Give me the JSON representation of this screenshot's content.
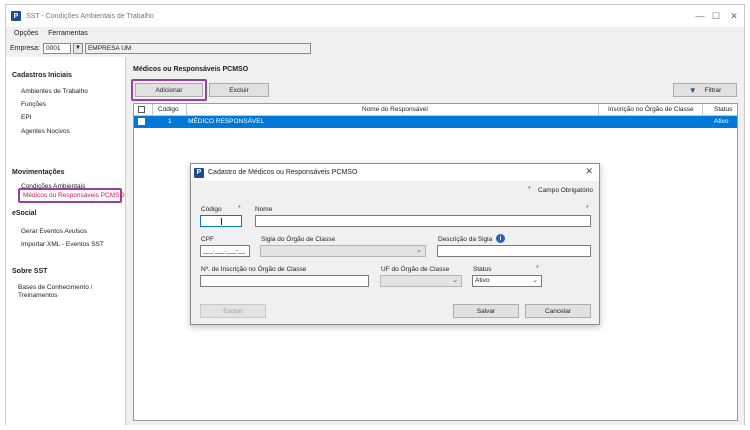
{
  "window": {
    "title": "SST - Condições Ambientais de Trabalho",
    "controls": {
      "minimize": "—",
      "maximize": "☐",
      "close": "✕"
    }
  },
  "menu": [
    "Opções",
    "Ferramentas"
  ],
  "empresa": {
    "label": "Empresa:",
    "code": "0001",
    "name": "EMPRESA UM"
  },
  "sidebar": {
    "sections": [
      {
        "title": "Cadastros Iniciais",
        "items": [
          "Ambientes de Trabalho",
          "Funções",
          "EPI",
          "Agentes Nocivos",
          "Médicos ou Responsáveis PCMSO"
        ]
      },
      {
        "title": "Movimentações",
        "items": [
          "Condições Ambientais"
        ]
      },
      {
        "title": "eSocial",
        "items": [
          "Gerar Eventos Avulsos",
          "Importar XML - Eventos SST"
        ]
      },
      {
        "title": "Sobre SST",
        "items": [
          "Bases de Conhecimento /",
          "Treinamentos"
        ]
      }
    ],
    "active_item": "Médicos ou Responsáveis PCMSO"
  },
  "main": {
    "title": "Médicos ou Responsáveis PCMSO",
    "buttons": {
      "add": "Adicionar",
      "delete": "Excluir",
      "filter": "Filtrar"
    },
    "grid": {
      "columns": [
        "Código",
        "Nome do Responsável",
        "Inscrição no Órgão de Classe",
        "Status"
      ],
      "rows": [
        {
          "codigo": "1",
          "nome": "MÉDICO RESPONSÁVEL",
          "inscricao": "",
          "status": "Ativo"
        }
      ]
    }
  },
  "dialog": {
    "title": "Cadastro de Médicos ou Responsáveis PCMSO",
    "required_note": "Campo Obrigatório",
    "required_mark": "*",
    "labels": {
      "codigo": "Código",
      "nome": "Nome",
      "cpf": "CPF",
      "sigla_orgao": "Sigla do Órgão de Classe",
      "descricao_sigla": "Descrição da Sigla",
      "inscricao": "Nº. de Inscrição no Órgão de Classe",
      "uf_orgao": "UF do Órgão de Classe",
      "status": "Status"
    },
    "values": {
      "codigo": "",
      "nome": "",
      "cpf": "___.___.___-__",
      "sigla_orgao": "",
      "descricao_sigla": "",
      "inscricao": "",
      "uf_orgao": "",
      "status": "Ativo"
    },
    "buttons": {
      "delete": "Excluir",
      "save": "Salvar",
      "cancel": "Cancelar"
    },
    "close": "✕"
  },
  "colors": {
    "accent": "#0078d7",
    "highlight": "#9b3fa0",
    "active_text": "#d4145a",
    "required": "#e02020"
  }
}
